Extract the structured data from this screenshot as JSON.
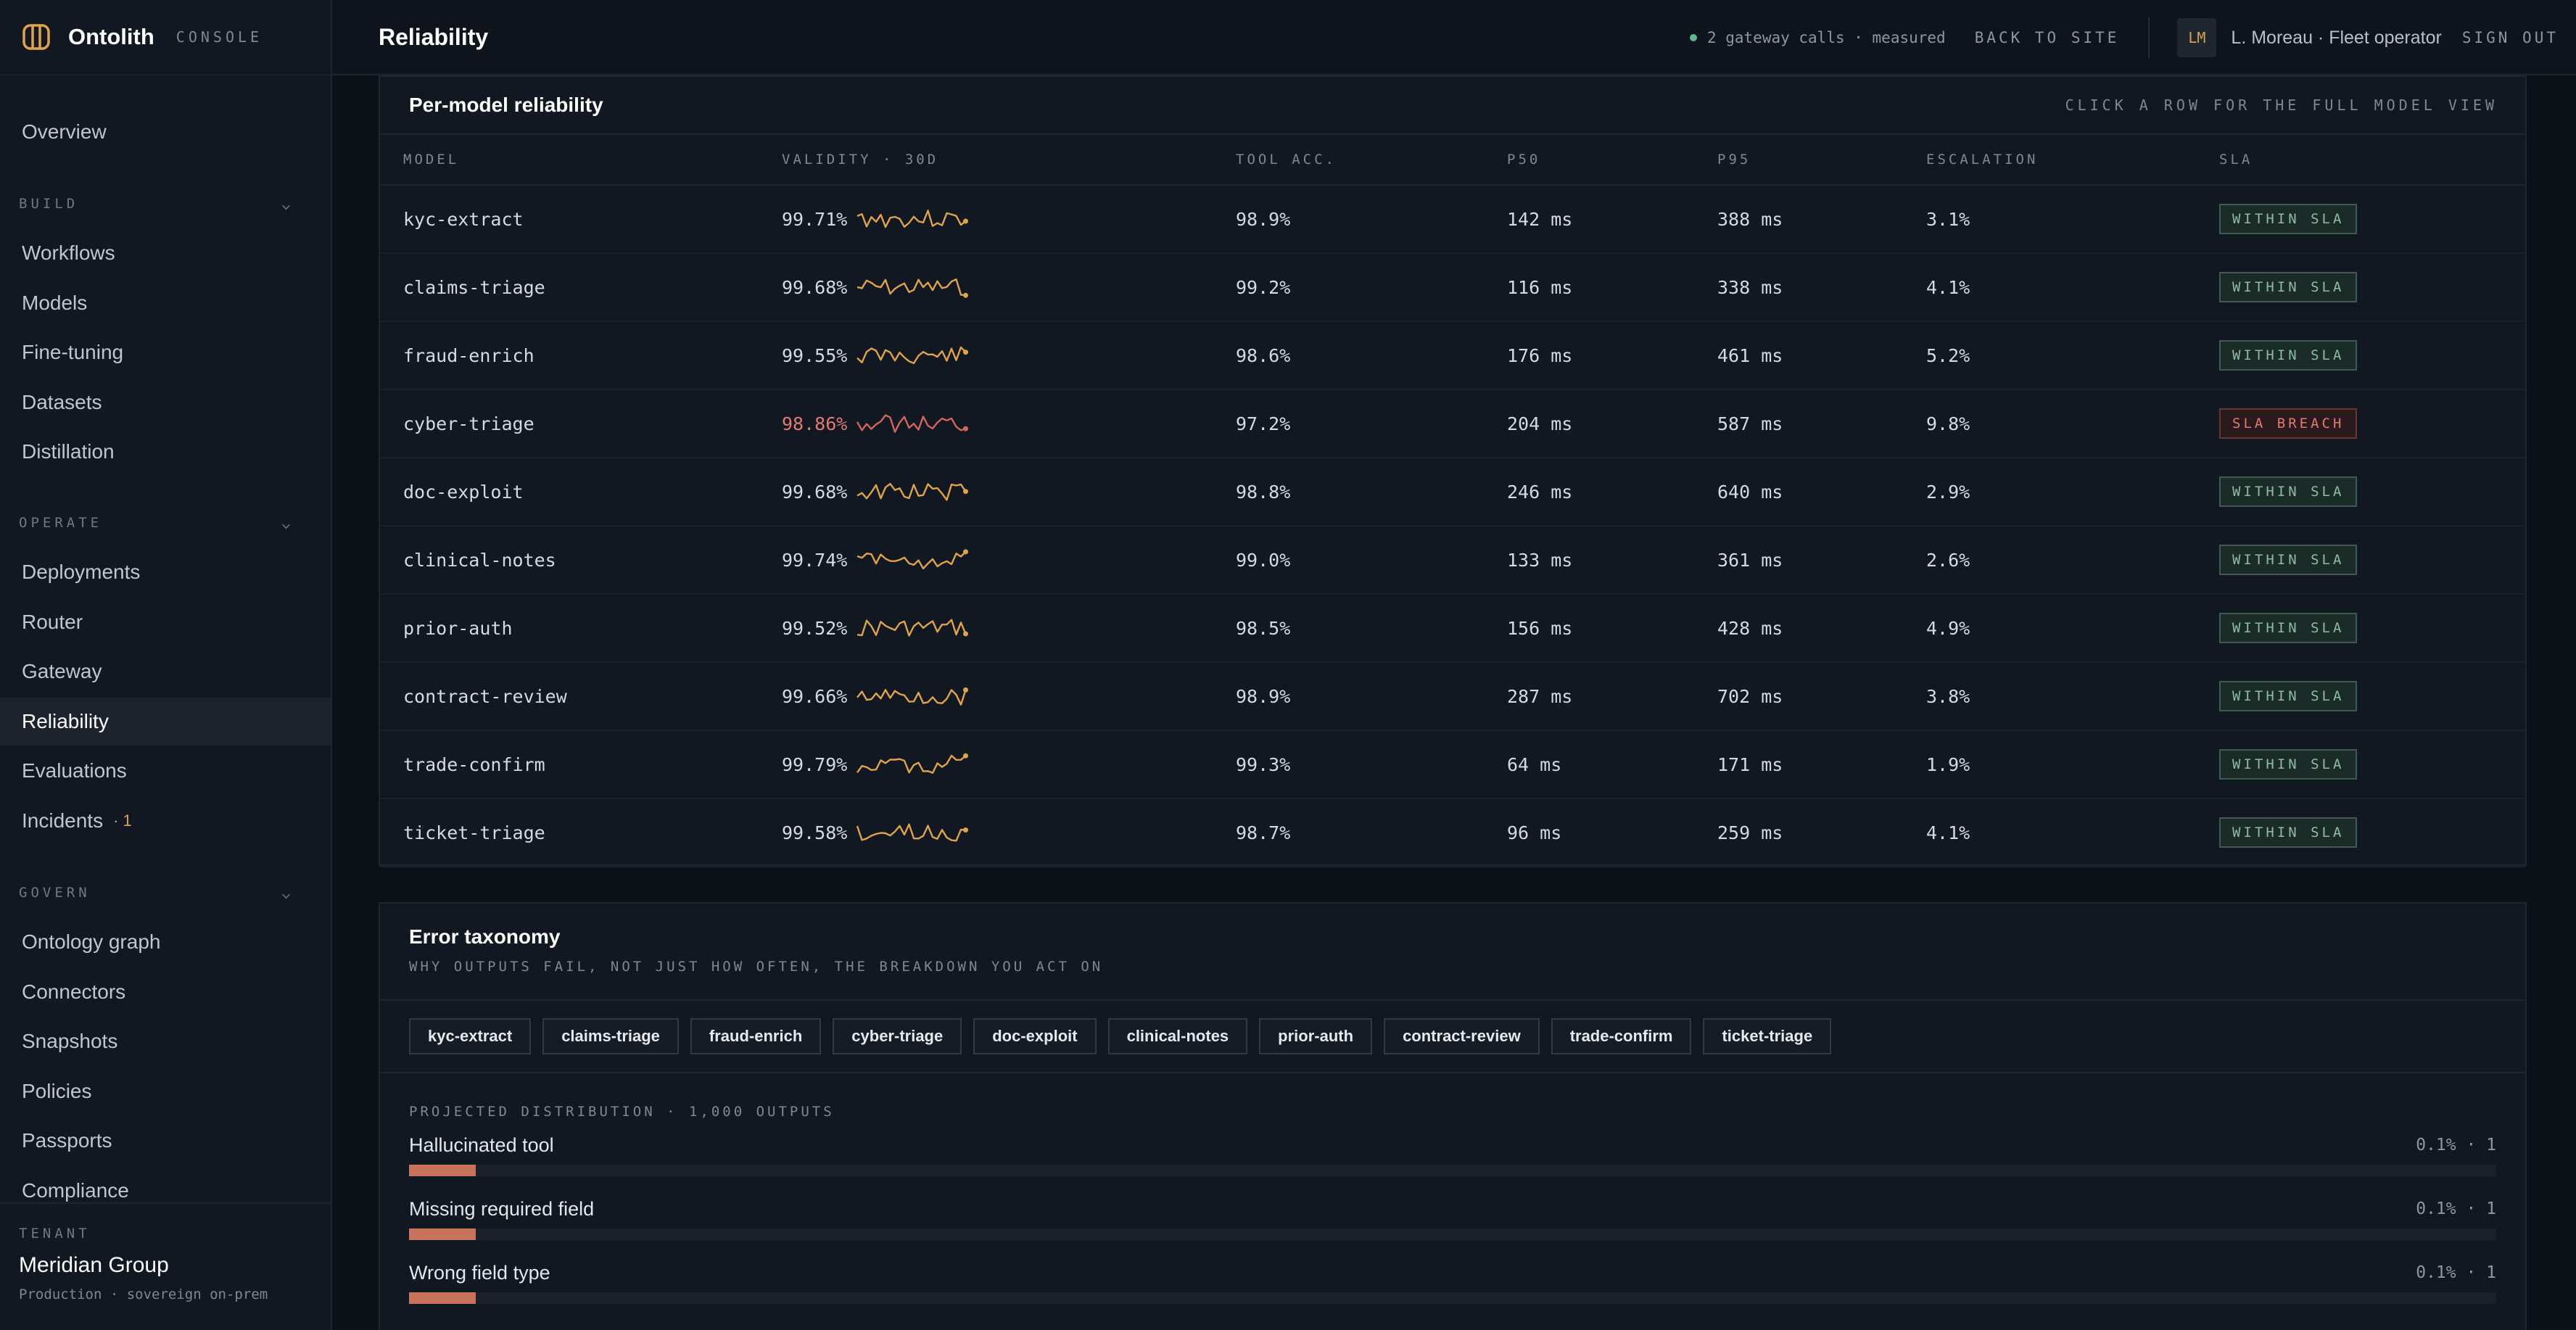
{
  "brand": {
    "name": "Ontolith",
    "tag": "CONSOLE",
    "accent": "#e0a34a"
  },
  "sidebar": {
    "overview": "Overview",
    "sections": [
      {
        "label": "BUILD",
        "items": [
          "Workflows",
          "Models",
          "Fine-tuning",
          "Datasets",
          "Distillation"
        ]
      },
      {
        "label": "OPERATE",
        "items": [
          "Deployments",
          "Router",
          "Gateway",
          "Reliability",
          "Evaluations",
          "Incidents"
        ]
      },
      {
        "label": "GOVERN",
        "items": [
          "Ontology graph",
          "Connectors",
          "Snapshots",
          "Policies",
          "Passports",
          "Compliance"
        ]
      }
    ],
    "active": "Reliability",
    "incidents_badge": "· 1",
    "tenant": {
      "label": "TENANT",
      "name": "Meridian Group",
      "sub": "Production · sovereign on-prem"
    }
  },
  "topbar": {
    "title": "Reliability",
    "status": "2 gateway calls · measured",
    "back": "BACK TO SITE",
    "avatar": "LM",
    "user": "L. Moreau · Fleet operator",
    "sign_out": "SIGN OUT"
  },
  "models_panel": {
    "title": "Per-model reliability",
    "hint": "CLICK A ROW FOR THE FULL MODEL VIEW",
    "columns": [
      "MODEL",
      "VALIDITY · 30D",
      "TOOL ACC.",
      "P50",
      "P95",
      "ESCALATION",
      "SLA"
    ],
    "rows": [
      {
        "model": "kyc-extract",
        "validity": "99.71%",
        "tool": "98.9%",
        "p50": "142 ms",
        "p95": "388 ms",
        "esc": "3.1%",
        "sla": "WITHIN SLA",
        "breach": false
      },
      {
        "model": "claims-triage",
        "validity": "99.68%",
        "tool": "99.2%",
        "p50": "116 ms",
        "p95": "338 ms",
        "esc": "4.1%",
        "sla": "WITHIN SLA",
        "breach": false
      },
      {
        "model": "fraud-enrich",
        "validity": "99.55%",
        "tool": "98.6%",
        "p50": "176 ms",
        "p95": "461 ms",
        "esc": "5.2%",
        "sla": "WITHIN SLA",
        "breach": false
      },
      {
        "model": "cyber-triage",
        "validity": "98.86%",
        "tool": "97.2%",
        "p50": "204 ms",
        "p95": "587 ms",
        "esc": "9.8%",
        "sla": "SLA BREACH",
        "breach": true
      },
      {
        "model": "doc-exploit",
        "validity": "99.68%",
        "tool": "98.8%",
        "p50": "246 ms",
        "p95": "640 ms",
        "esc": "2.9%",
        "sla": "WITHIN SLA",
        "breach": false
      },
      {
        "model": "clinical-notes",
        "validity": "99.74%",
        "tool": "99.0%",
        "p50": "133 ms",
        "p95": "361 ms",
        "esc": "2.6%",
        "sla": "WITHIN SLA",
        "breach": false
      },
      {
        "model": "prior-auth",
        "validity": "99.52%",
        "tool": "98.5%",
        "p50": "156 ms",
        "p95": "428 ms",
        "esc": "4.9%",
        "sla": "WITHIN SLA",
        "breach": false
      },
      {
        "model": "contract-review",
        "validity": "99.66%",
        "tool": "98.9%",
        "p50": "287 ms",
        "p95": "702 ms",
        "esc": "3.8%",
        "sla": "WITHIN SLA",
        "breach": false
      },
      {
        "model": "trade-confirm",
        "validity": "99.79%",
        "tool": "99.3%",
        "p50": "64 ms",
        "p95": "171 ms",
        "esc": "1.9%",
        "sla": "WITHIN SLA",
        "breach": false
      },
      {
        "model": "ticket-triage",
        "validity": "99.58%",
        "tool": "98.7%",
        "p50": "96 ms",
        "p95": "259 ms",
        "esc": "4.1%",
        "sla": "WITHIN SLA",
        "breach": false
      }
    ],
    "colors": {
      "spark_ok": "#e0a34a",
      "spark_breach": "#d0665c",
      "breach_text": "#e07b6f"
    }
  },
  "errors_panel": {
    "title": "Error taxonomy",
    "subtitle": "WHY OUTPUTS FAIL, NOT JUST HOW OFTEN, THE BREAKDOWN YOU ACT ON",
    "chips": [
      "kyc-extract",
      "claims-triage",
      "fraud-enrich",
      "cyber-triage",
      "doc-exploit",
      "clinical-notes",
      "prior-auth",
      "contract-review",
      "trade-confirm",
      "ticket-triage"
    ],
    "dist_label": "PROJECTED DISTRIBUTION · 1,000 OUTPUTS",
    "rows": [
      {
        "name": "Hallucinated tool",
        "value": "0.1% · 1",
        "share": 0.032
      },
      {
        "name": "Missing required field",
        "value": "0.1% · 1",
        "share": 0.032
      },
      {
        "name": "Wrong field type",
        "value": "0.1% · 1",
        "share": 0.032
      }
    ]
  }
}
